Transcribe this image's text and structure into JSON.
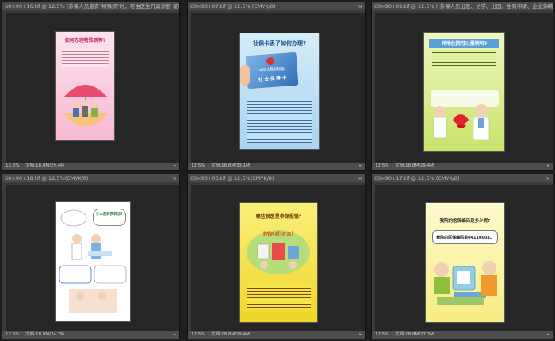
{
  "windows": [
    {
      "title": "60×90+16.tif @ 12.5% (参保人员患有\"特殊病\"时，可由医生开具诊断 证明) ...",
      "zoom": "12.5%",
      "doc": "文档:18.8M/29.4M",
      "poster": {
        "title": "如何办理特殊病等?",
        "caption": ""
      }
    },
    {
      "title": "60×90+07.tif @ 12.5% (CMYK/8)",
      "zoom": "12.5%",
      "doc": "文档:18.8M/33.1M",
      "poster": {
        "title": "社保卡丢了如何办理?",
        "card_line1": "中华人民共和国",
        "card_line2": "社 会 保 障 卡",
        "caption": ""
      }
    },
    {
      "title": "60×90+02.tif @ 12.5% ( 参保人员出差、访学、出国、生育申请、企业外聘、工作 ...",
      "zoom": "12.5%",
      "doc": "文档:18.8M/29.4M",
      "poster": {
        "title": "异地住院可以报销吗?",
        "caption": ""
      }
    },
    {
      "title": "60×90+18.tif @ 12.5%(CMYK/8)",
      "zoom": "12.5%",
      "doc": "文档:18.8M/24.7M",
      "poster": {
        "title": "什么是转院转诊?",
        "caption": ""
      }
    },
    {
      "title": "60×90+06.tif @ 12.5%(CMYK/8)",
      "zoom": "12.5%",
      "doc": "文档:18.8M/29.4M",
      "poster": {
        "title": "哪些就医是参保报销?",
        "caption": ""
      }
    },
    {
      "title": "60×90+17.tif @ 12.5% (CMYK/8)",
      "zoom": "12.5%",
      "doc": "文档:18.8M/27.3M",
      "poster": {
        "title": "我院的医保编码是多少呢?",
        "code_line": "我院的医保编码是04110003。",
        "caption": ""
      }
    }
  ],
  "colors": {
    "app_bg": "#1e1e1e",
    "panel_bg": "#262626",
    "poster1_bg": "#f9c8dc",
    "poster2_bg": "#bfe0f5",
    "poster3_bg": "#d8ec8a",
    "poster4_bg": "#ffffff",
    "poster5_bg": "#f5e34a",
    "poster6_bg": "#fbf7a8"
  }
}
